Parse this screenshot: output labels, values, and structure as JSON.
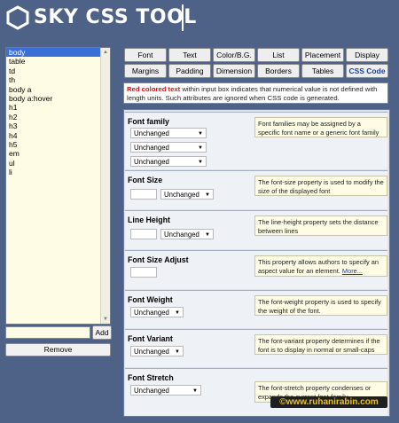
{
  "app": {
    "title": "SKY CSS TOOL"
  },
  "selectors": {
    "items": [
      "body",
      "table",
      "td",
      "th",
      "body a",
      "body a:hover",
      "h1",
      "h2",
      "h3",
      "h4",
      "h5",
      "em",
      "ul",
      "li"
    ],
    "selected_index": 0
  },
  "controls": {
    "add_label": "Add",
    "remove_label": "Remove",
    "new_selector_value": ""
  },
  "tabs": {
    "row1": [
      "Font",
      "Text",
      "Color/B.G.",
      "List",
      "Placement",
      "Display"
    ],
    "row2": [
      "Margins",
      "Padding",
      "Dimension",
      "Borders",
      "Tables",
      "CSS Code"
    ],
    "active": "CSS Code"
  },
  "info": {
    "red_part": "Red colored text",
    "rest": " within input box indicates that numerical value is not defined with length units. Such attributes are ignored when CSS code is generated."
  },
  "properties": {
    "font_family": {
      "title": "Font family",
      "selects": [
        "Unchanged",
        "Unchanged",
        "Unchanged"
      ],
      "desc": "Font families may be assigned by a specific font name or a generic font family"
    },
    "font_size": {
      "title": "Font Size",
      "select": "Unchanged",
      "value": "",
      "desc": "The font-size property is used to modify the size of the displayed font"
    },
    "line_height": {
      "title": "Line Height",
      "select": "Unchanged",
      "value": "",
      "desc": "The line-height property sets the distance between lines"
    },
    "font_size_adjust": {
      "title": "Font Size Adjust",
      "value": "",
      "desc": "This property allows authors to specify an aspect value for an element.",
      "more": "More..."
    },
    "font_weight": {
      "title": "Font Weight",
      "select": "Unchanged",
      "desc": "The font-weight property is used to specify the weight of the font."
    },
    "font_variant": {
      "title": "Font Variant",
      "select": "Unchanged",
      "desc": "The font-variant property determines if the font is to display in normal or small-caps"
    },
    "font_stretch": {
      "title": "Font Stretch",
      "select": "Unchanged",
      "desc": "The font-stretch property condenses or expands the current font-family"
    }
  },
  "watermark": "©www.ruhanirabin.com",
  "colors": {
    "background": "#4e6187",
    "selection": "#3a6fd8",
    "info_red": "#cc1616",
    "watermark_text": "#f5c400"
  }
}
